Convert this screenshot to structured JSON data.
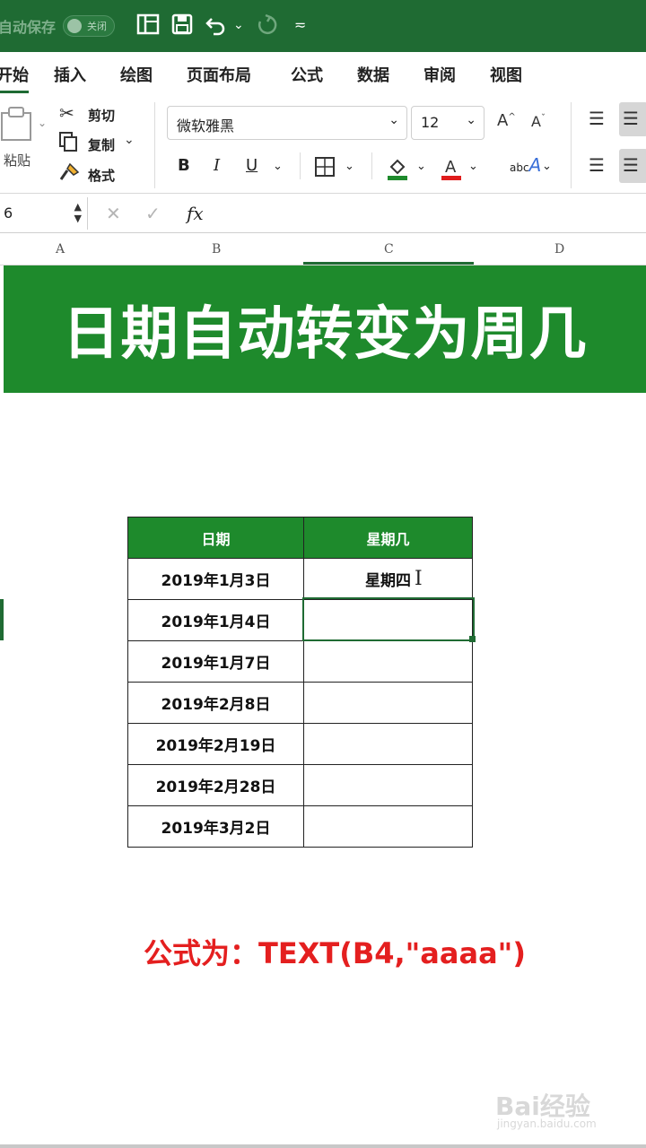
{
  "titlebar": {
    "autosave_label": "自动保存",
    "toggle_label": "关闭",
    "icons": [
      "layout-icon",
      "save-icon",
      "undo-icon",
      "redo-icon",
      "customize-icon"
    ]
  },
  "tabs": [
    "开始",
    "插入",
    "绘图",
    "页面布局",
    "公式",
    "数据",
    "审阅",
    "视图"
  ],
  "clipboard": {
    "paste_label": "粘贴",
    "cut_label": "剪切",
    "copy_label": "复制",
    "format_label": "格式"
  },
  "font": {
    "family": "微软雅黑",
    "size": "12"
  },
  "formula_bar": {
    "name_box": "6",
    "fx_label": "fx",
    "value": ""
  },
  "columns": [
    "A",
    "B",
    "C",
    "D"
  ],
  "banner": {
    "title": "日期自动转变为周几",
    "color": "#1e8a2c"
  },
  "table": {
    "headers": [
      "日期",
      "星期几"
    ],
    "rows": [
      [
        "2019年1月3日",
        "星期四"
      ],
      [
        "2019年1月4日",
        ""
      ],
      [
        "2019年1月7日",
        ""
      ],
      [
        "2019年2月8日",
        ""
      ],
      [
        "2019年2月19日",
        ""
      ],
      [
        "2019年2月28日",
        ""
      ],
      [
        "2019年3月2日",
        ""
      ]
    ]
  },
  "caption": "公式为：TEXT(B4,\"aaaa\")",
  "watermark": {
    "brand": "Bai经验",
    "url": "jingyan.baidu.com"
  }
}
